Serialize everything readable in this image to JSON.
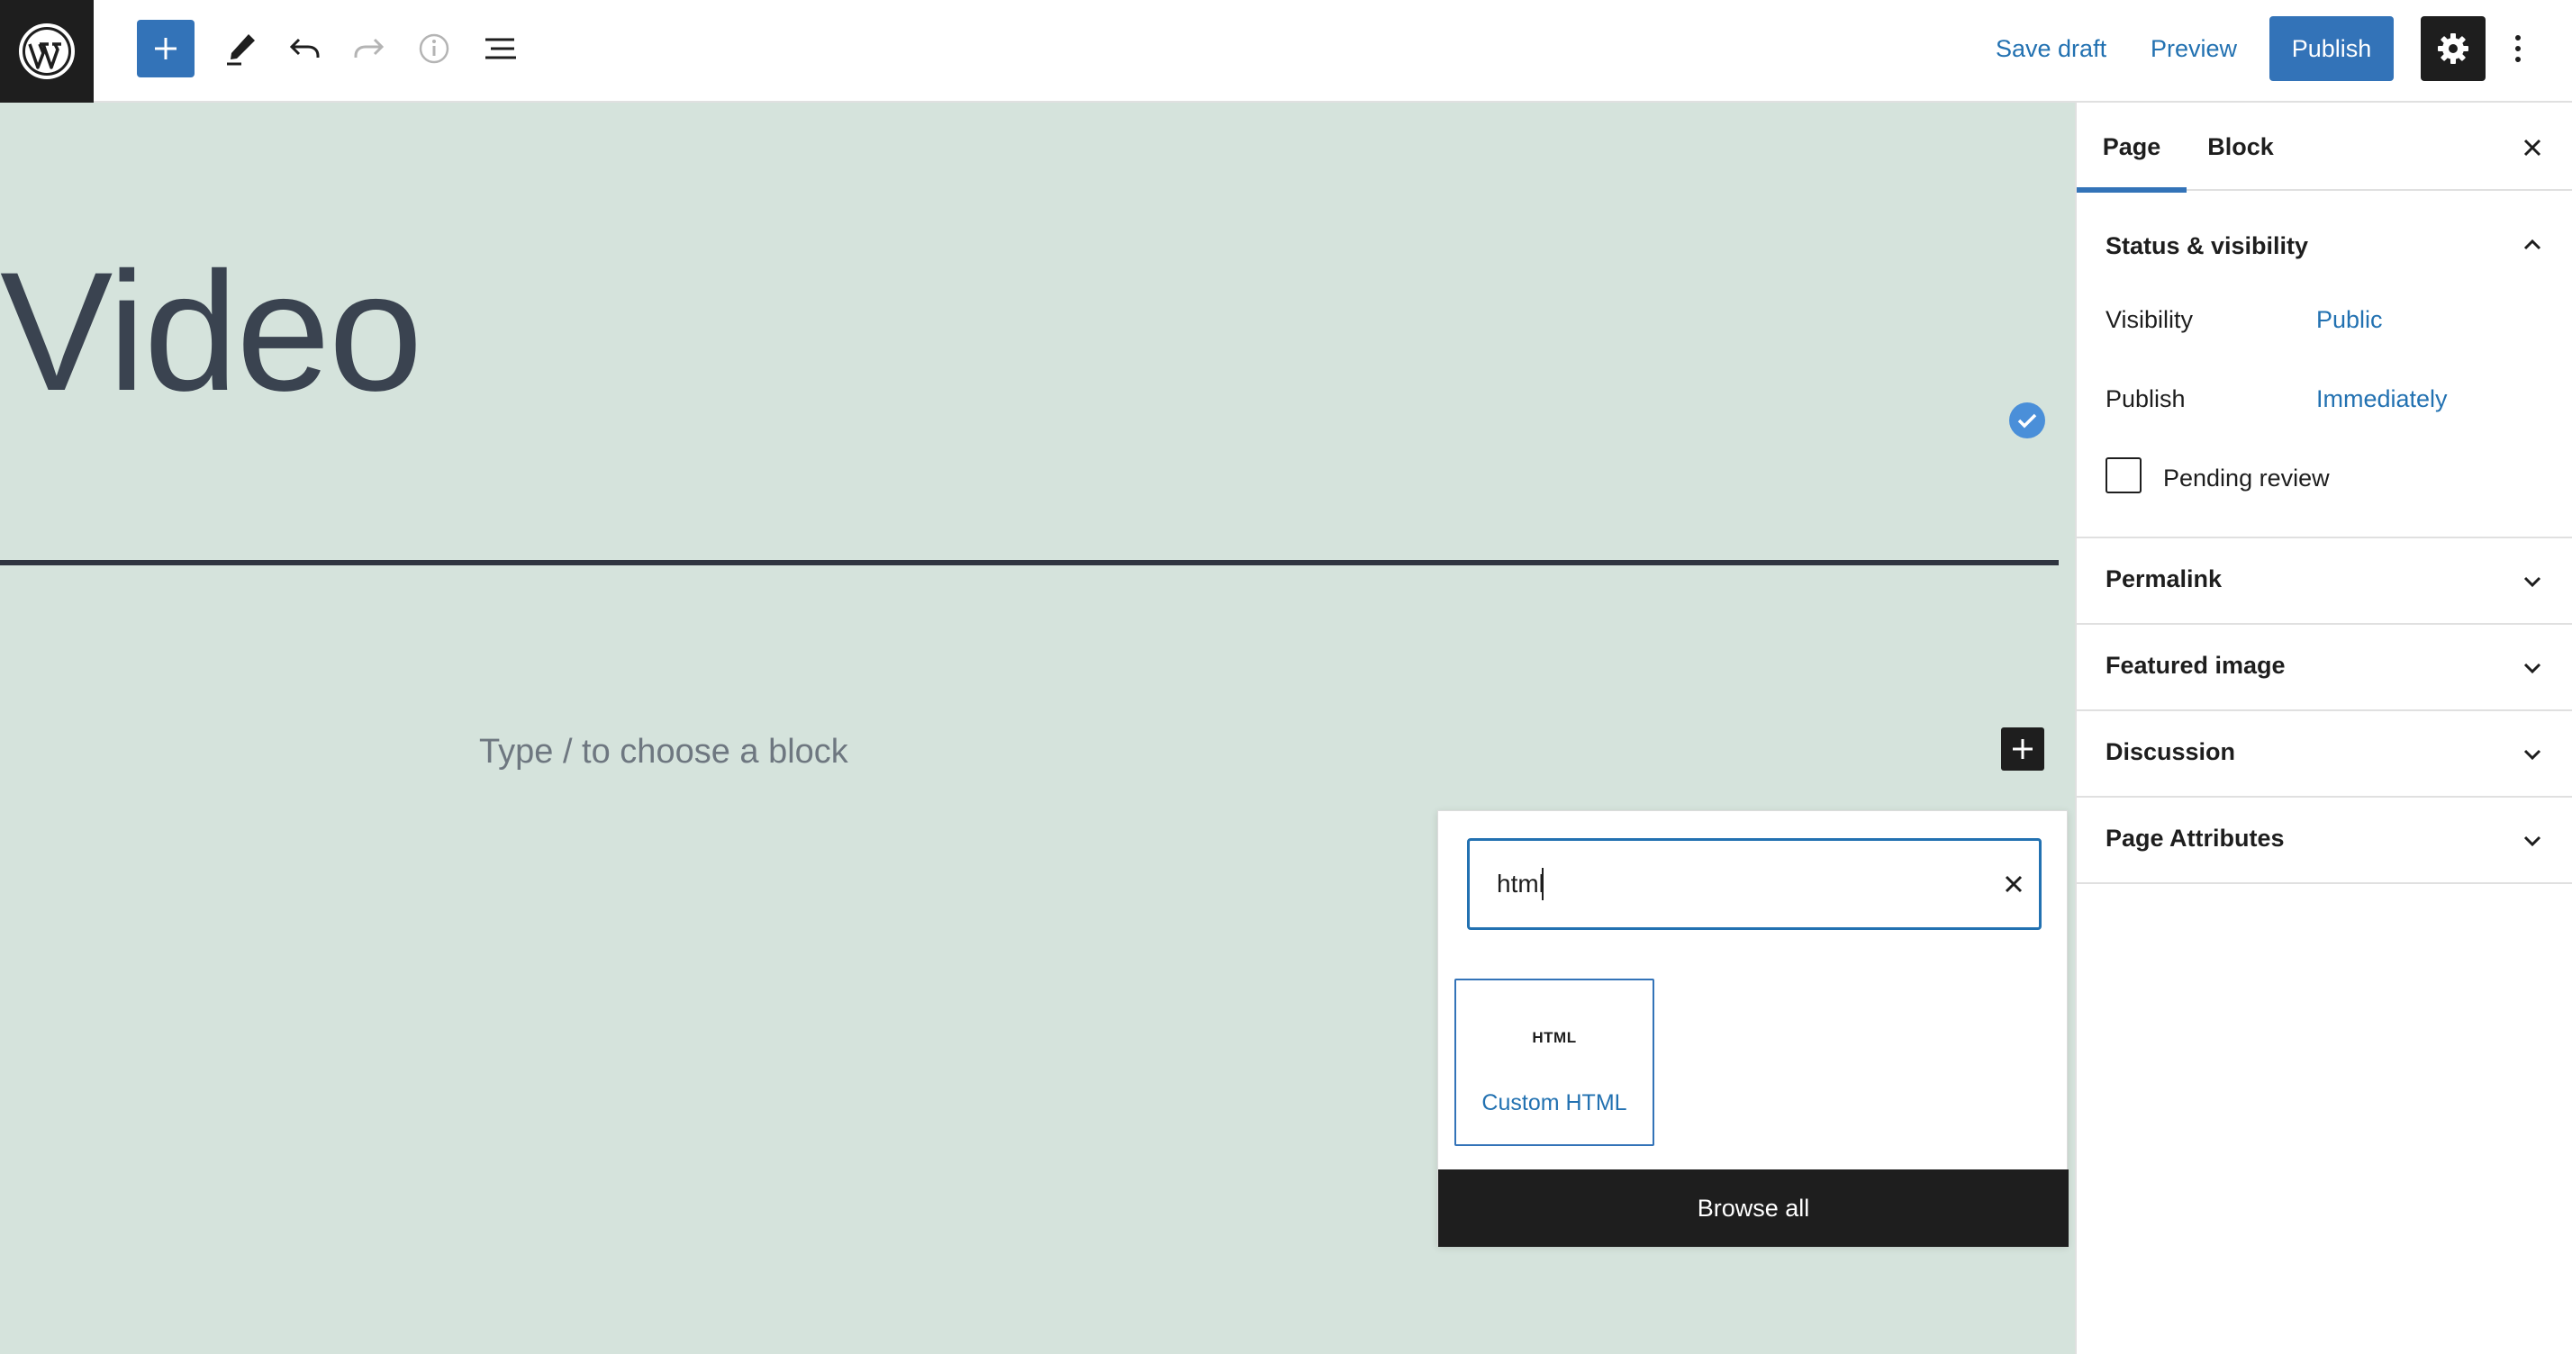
{
  "toolbar": {
    "logo_icon": "wordpress-logo",
    "add_icon": "plus-icon",
    "tools_icon": "pencil-icon",
    "undo_icon": "undo-icon",
    "redo_icon": "redo-icon",
    "info_icon": "info-icon",
    "list_view_icon": "list-view-icon",
    "save_draft": "Save draft",
    "preview": "Preview",
    "publish": "Publish",
    "settings_icon": "gear-icon",
    "more_icon": "more-vertical-icon"
  },
  "editor": {
    "title": "Video",
    "placeholder": "Type / to choose a block",
    "background_color": "#d5e3dc"
  },
  "inserter": {
    "search_value": "html",
    "results": [
      {
        "icon_text": "HTML",
        "label": "Custom HTML"
      }
    ],
    "browse_all": "Browse all"
  },
  "sidebar": {
    "tabs": [
      {
        "label": "Page",
        "active": true
      },
      {
        "label": "Block",
        "active": false
      }
    ],
    "status_panel": {
      "title": "Status & visibility",
      "expanded": true,
      "visibility_label": "Visibility",
      "visibility_value": "Public",
      "publish_label": "Publish",
      "publish_value": "Immediately",
      "pending_review_label": "Pending review",
      "pending_review_checked": false
    },
    "panels": [
      {
        "title": "Permalink"
      },
      {
        "title": "Featured image"
      },
      {
        "title": "Discussion"
      },
      {
        "title": "Page Attributes"
      }
    ]
  },
  "colors": {
    "accent": "#3373b8",
    "link": "#2271b1",
    "dark": "#1e1e1e"
  }
}
